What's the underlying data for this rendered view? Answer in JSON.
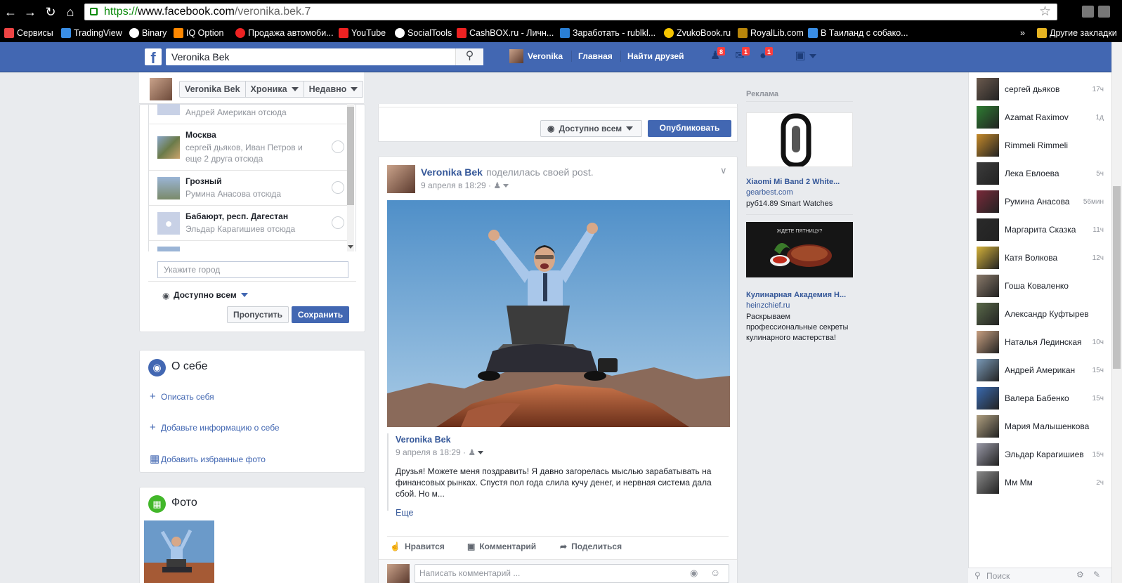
{
  "browser": {
    "url_protocol": "https://",
    "url_host": "www.facebook.com",
    "url_path": "/veronika.bek.7",
    "bookmarks": [
      {
        "label": "Сервисы",
        "color": "#e44"
      },
      {
        "label": "TradingView",
        "color": "#3a8ee6"
      },
      {
        "label": "Binary",
        "color": "#ffffff"
      },
      {
        "label": "IQ Option",
        "color": "#ff8800"
      },
      {
        "label": "Продажа автомоби...",
        "color": "#e22"
      },
      {
        "label": "YouTube",
        "color": "#e22"
      },
      {
        "label": "SocialTools",
        "color": "#ffffff"
      },
      {
        "label": "CashBOX.ru - Личн...",
        "color": "#e22"
      },
      {
        "label": "Заработать - rublkl...",
        "color": "#2a7fd4"
      },
      {
        "label": "ZvukoBook.ru",
        "color": "#f5c400"
      },
      {
        "label": "RoyalLib.com",
        "color": "#b8860b"
      },
      {
        "label": "В Таиланд с собако...",
        "color": "#3a8ee6"
      }
    ],
    "overflow_label": "»",
    "other_bookmarks": "Другие закладки"
  },
  "topbar": {
    "search_value": "Veronika Bek",
    "profile_name": "Veronika",
    "home_label": "Главная",
    "find_friends_label": "Найти друзей",
    "friend_requests_count": "8",
    "messages_count": "1",
    "notifications_count": "1"
  },
  "timeline_nav": {
    "name_btn": "Veronika Bek",
    "timeline_btn": "Хроника",
    "recent_btn": "Недавно"
  },
  "cities": [
    {
      "name": "",
      "sub": "Андрей Американ отсюда"
    },
    {
      "name": "Москва",
      "sub": "сергей дьяков, Иван Петров и еще 2 друга отсюда"
    },
    {
      "name": "Грозный",
      "sub": "Румина Анасова отсюда"
    },
    {
      "name": "Бабаюрт, респ. Дагестан",
      "sub": "Эльдар Карагишиев отсюда"
    }
  ],
  "city_form": {
    "placeholder": "Укажите город",
    "privacy": "Доступно всем",
    "skip": "Пропустить",
    "save": "Сохранить"
  },
  "about": {
    "title": "О себе",
    "links": [
      "Описать себя",
      "Добавьте информацию о себе",
      "Добавить избранные фото"
    ]
  },
  "photos": {
    "title": "Фото"
  },
  "composer": {
    "privacy": "Доступно всем",
    "publish": "Опубликовать"
  },
  "post": {
    "author": "Veronika Bek",
    "action": "поделилась своей post.",
    "date": "9 апреля в 18:29 ·",
    "shared_author": "Veronika Bek",
    "shared_date": "9 апреля в 18:29 ·",
    "shared_text": "Друзья! Можете меня поздравить! Я давно загорелась мыслью зарабатывать на финансовых рынках. Спустя пол года слила кучу денег, и нервная система дала сбой. Но м...",
    "more": "Еще",
    "like": "Нравится",
    "comment": "Комментарий",
    "share": "Поделиться",
    "comment_placeholder": "Написать комментарий ..."
  },
  "ads": {
    "title": "Реклама",
    "ad1_title": "Xiaomi Mi Band 2 White...",
    "ad1_domain": "gearbest.com",
    "ad1_text": "руб14.89 Smart Watches",
    "ad2_banner": "ЖДЕТЕ ПЯТНИЦУ?",
    "ad2_title": "Кулинарная Академия Н...",
    "ad2_domain": "heinzchief.ru",
    "ad2_text": "Раскрываем профессиональные секреты кулинарного мастерства!"
  },
  "chat": {
    "contacts": [
      {
        "name": "сергей дьяков",
        "time": "17ч",
        "color": "#6b5a4e"
      },
      {
        "name": "Azamat Raximov",
        "time": "1д",
        "color": "#2e7d32"
      },
      {
        "name": "Rimmeli Rimmeli",
        "time": "",
        "color": "#c58a2a"
      },
      {
        "name": "Лека Евлоева",
        "time": "5ч",
        "color": "#3c3c3c"
      },
      {
        "name": "Румина Анасова",
        "time": "56мин",
        "color": "#7a2a3a"
      },
      {
        "name": "Маргарита Сказка",
        "time": "11ч",
        "color": "#2a2a2a"
      },
      {
        "name": "Катя Волкова",
        "time": "12ч",
        "color": "#d4b23a"
      },
      {
        "name": "Гоша Коваленко",
        "time": "",
        "color": "#8a7a6a"
      },
      {
        "name": "Александр Куфтырев",
        "time": "",
        "color": "#5a6a4a"
      },
      {
        "name": "Наталья Лединская",
        "time": "10ч",
        "color": "#c8a080"
      },
      {
        "name": "Андрей Американ",
        "time": "15ч",
        "color": "#7a9ab8"
      },
      {
        "name": "Валера Бабенко",
        "time": "15ч",
        "color": "#3a6ab0"
      },
      {
        "name": "Мария Малышенкова",
        "time": "",
        "color": "#b0a080"
      },
      {
        "name": "Эльдар Карагишиев",
        "time": "15ч",
        "color": "#9a9aa8"
      },
      {
        "name": "Мм Мм",
        "time": "2ч",
        "color": "#8a8a8a"
      }
    ],
    "search_placeholder": "Поиск"
  }
}
